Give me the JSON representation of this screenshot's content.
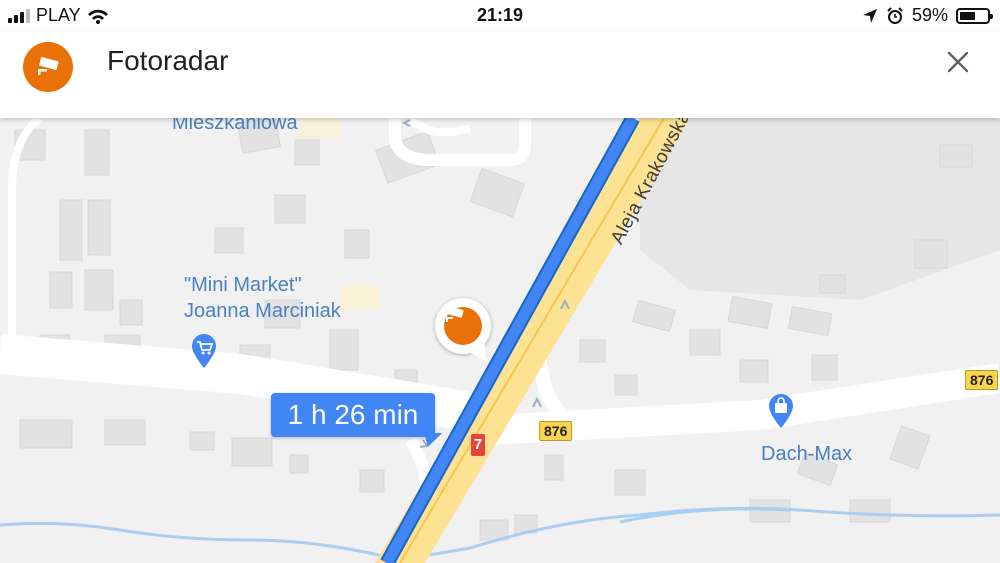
{
  "status_bar": {
    "carrier": "PLAY",
    "time": "21:19",
    "battery_percent": "59%",
    "battery_level": 0.59,
    "icons": [
      "signal-icon",
      "wifi-icon",
      "location-arrow-icon",
      "alarm-icon",
      "battery-icon"
    ]
  },
  "header": {
    "title": "Fotoradar",
    "icon": "speed-camera-icon",
    "close_icon": "close-icon",
    "accent_color": "#e8710a"
  },
  "map": {
    "labels": {
      "mieszkaniowa": "Mieszkaniowa",
      "market_line1": "\"Mini Market\"",
      "market_line2": "Joanna Marciniak",
      "dach_max": "Dach-Max",
      "street": "Aleja Krakowska"
    },
    "road_numbers": {
      "road_876_right": "876",
      "road_876_mid": "876",
      "road_7": "7"
    },
    "route_time": "1 h 26 min",
    "route_color": "#4285f4",
    "camera_marker_icon": "speed-camera-icon",
    "poi_icons": [
      "shopping-cart-icon",
      "shopping-bag-icon"
    ]
  }
}
